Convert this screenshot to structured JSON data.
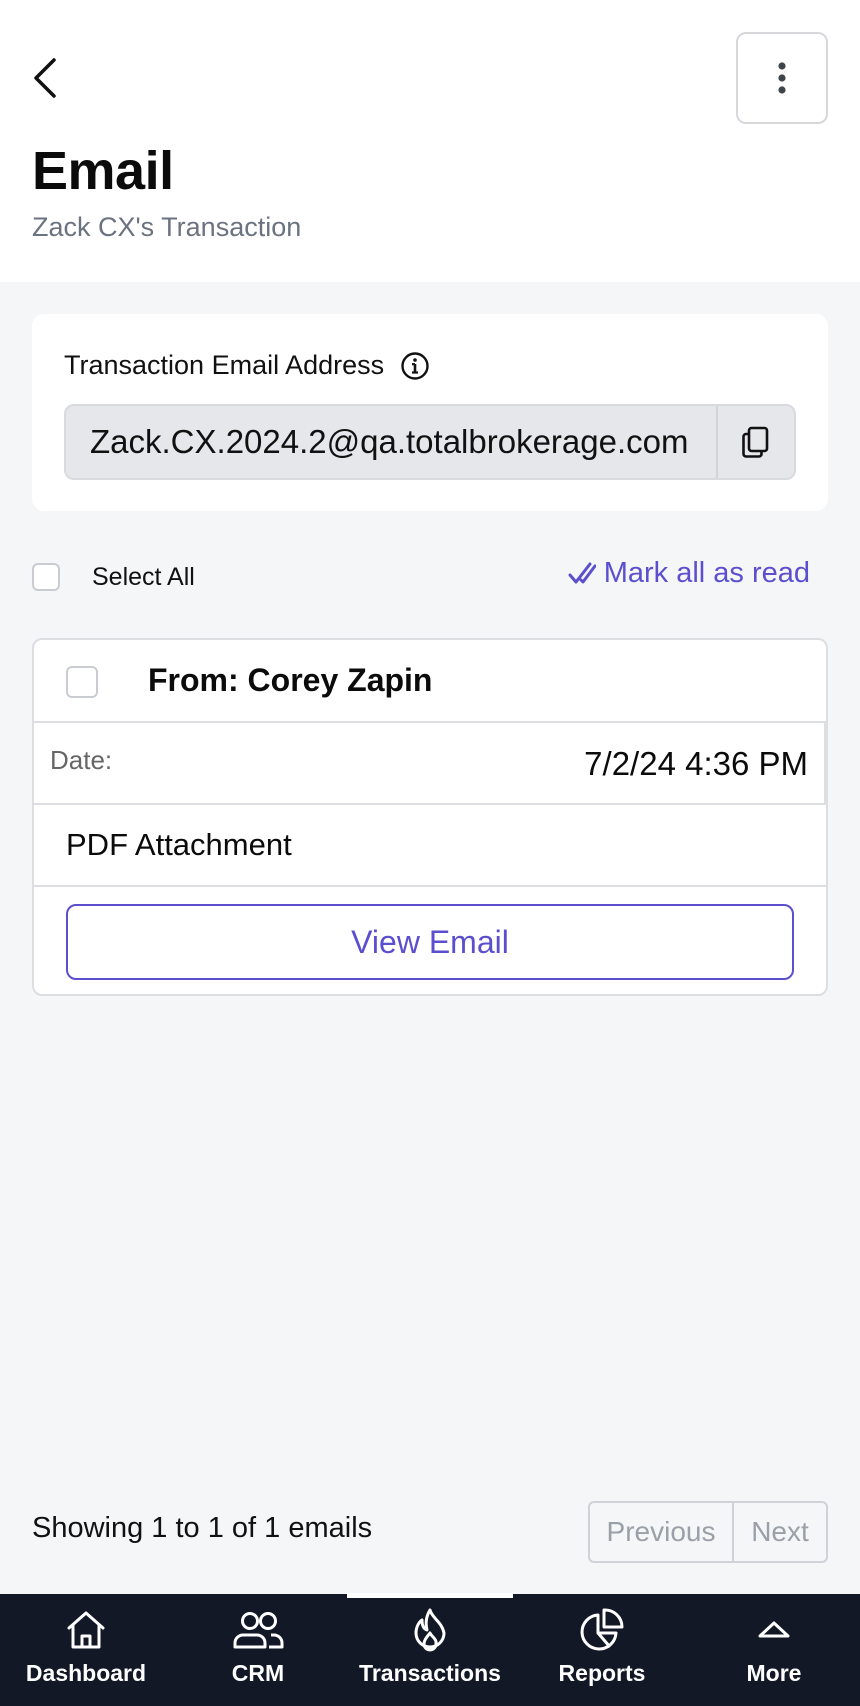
{
  "header": {
    "title": "Email",
    "subtitle": "Zack CX's Transaction"
  },
  "address_card": {
    "label": "Transaction Email Address",
    "email": "Zack.CX.2024.2@qa.totalbrokerage.com"
  },
  "toolbar": {
    "select_all_label": "Select All",
    "mark_all_read_label": "Mark all as read"
  },
  "emails": [
    {
      "from": "From: Corey Zapin",
      "date_label": "Date:",
      "date_value": "7/2/24 4:36 PM",
      "attachment": "PDF Attachment",
      "view_label": "View Email"
    }
  ],
  "pagination": {
    "summary": "Showing 1 to 1 of 1 emails",
    "previous_label": "Previous",
    "next_label": "Next"
  },
  "bottom_nav": {
    "items": [
      {
        "label": "Dashboard",
        "icon": "home-icon"
      },
      {
        "label": "CRM",
        "icon": "users-icon"
      },
      {
        "label": "Transactions",
        "icon": "flame-icon"
      },
      {
        "label": "Reports",
        "icon": "pie-chart-icon"
      },
      {
        "label": "More",
        "icon": "chevron-up-icon"
      }
    ],
    "active_index": 2
  },
  "colors": {
    "accent": "#5b4fcf",
    "nav_background": "#121826",
    "page_background": "#f5f6f8"
  }
}
